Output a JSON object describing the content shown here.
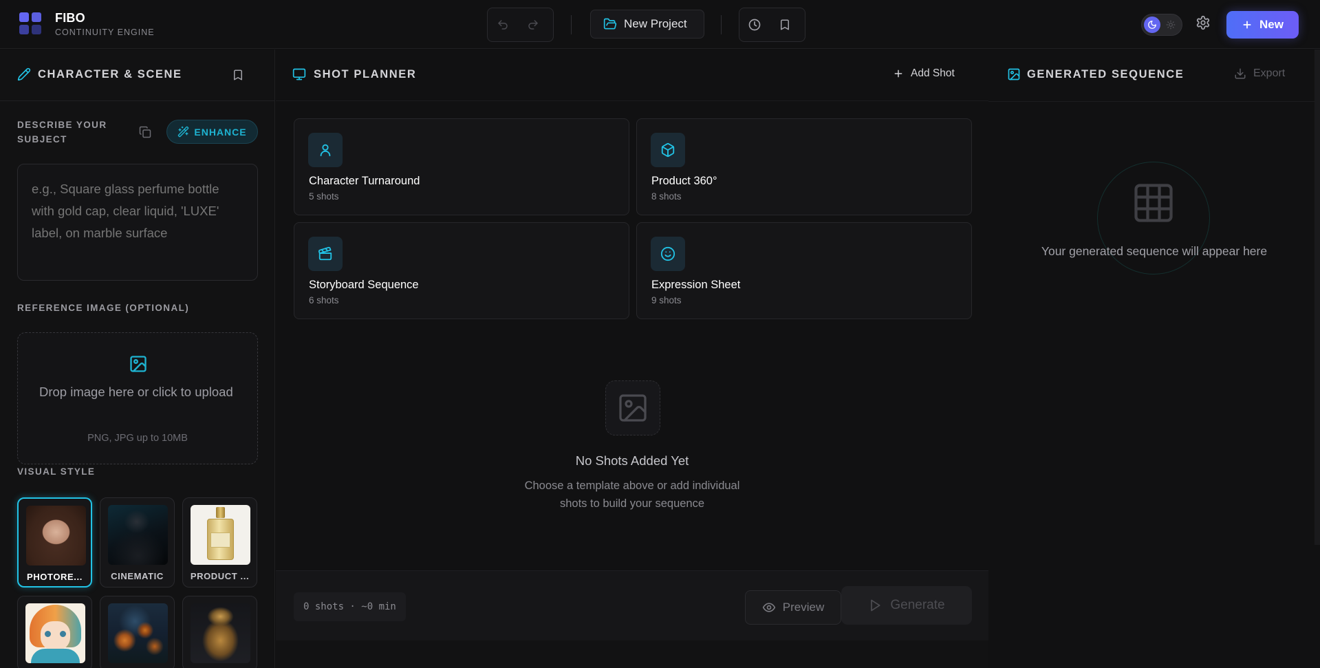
{
  "brand": {
    "title": "FIBO",
    "subtitle": "CONTINUITY ENGINE",
    "logo_colors": [
      "#6366f1",
      "#4f46e5",
      "#3730a3",
      "#312e81"
    ]
  },
  "header": {
    "new_project_label": "New Project",
    "new_label": "New",
    "icons": [
      "undo-icon",
      "redo-icon",
      "history-icon",
      "bookmark-icon",
      "moon-icon",
      "sun-icon",
      "gear-icon",
      "plus-icon"
    ]
  },
  "left_panel": {
    "title": "CHARACTER & SCENE",
    "describe_label": "DESCRIBE YOUR SUBJECT",
    "enhance_label": "ENHANCE",
    "subject_placeholder": "e.g., Square glass perfume bottle with gold cap, clear liquid, 'LUXE' label, on marble surface",
    "subject_value": "",
    "reference_label": "REFERENCE IMAGE (OPTIONAL)",
    "drop_text": "Drop image here or click to upload",
    "drop_hint": "PNG, JPG up to 10MB",
    "visual_style_label": "VISUAL STYLE",
    "styles": [
      {
        "label": "PHOTORE...",
        "selected": true
      },
      {
        "label": "CINEMATIC",
        "selected": false
      },
      {
        "label": "PRODUCT ...",
        "selected": false
      },
      {
        "label": "",
        "selected": false
      },
      {
        "label": "",
        "selected": false
      },
      {
        "label": "",
        "selected": false
      }
    ]
  },
  "center_panel": {
    "title": "SHOT PLANNER",
    "add_shot_label": "Add Shot",
    "templates": [
      {
        "name": "Character Turnaround",
        "count": "5 shots",
        "icon": "person-icon"
      },
      {
        "name": "Product 360°",
        "count": "8 shots",
        "icon": "cube-icon"
      },
      {
        "name": "Storyboard Sequence",
        "count": "6 shots",
        "icon": "clapperboard-icon"
      },
      {
        "name": "Expression Sheet",
        "count": "9 shots",
        "icon": "smile-icon"
      }
    ],
    "empty_title": "No Shots Added Yet",
    "empty_subtitle": "Choose a template above or add individual shots to build your sequence",
    "stats": "0 shots · ~0 min",
    "preview_label": "Preview",
    "generate_label": "Generate"
  },
  "right_panel": {
    "title": "GENERATED SEQUENCE",
    "export_label": "Export",
    "empty_text": "Your generated sequence will appear here"
  },
  "colors": {
    "accent": "#22c3e6",
    "primary": "#5b66f4",
    "background": "#111112"
  }
}
